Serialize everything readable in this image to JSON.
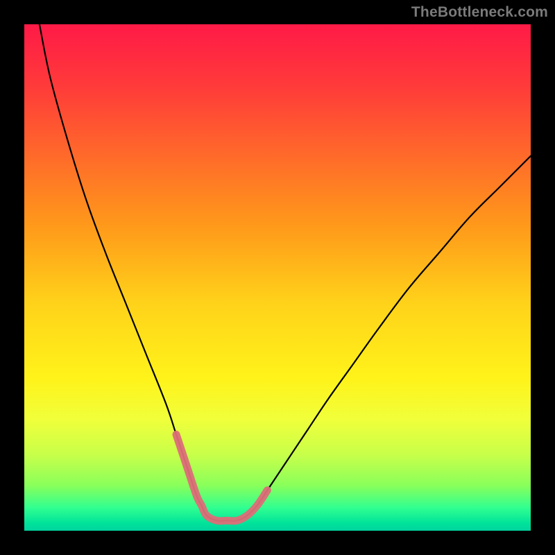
{
  "watermark": "TheBottleneck.com",
  "gradient": {
    "stops": [
      {
        "offset": 0.0,
        "color": "#ff1a47"
      },
      {
        "offset": 0.12,
        "color": "#ff3a3a"
      },
      {
        "offset": 0.26,
        "color": "#ff6a2a"
      },
      {
        "offset": 0.4,
        "color": "#ff9a1a"
      },
      {
        "offset": 0.55,
        "color": "#ffd21a"
      },
      {
        "offset": 0.7,
        "color": "#fff31a"
      },
      {
        "offset": 0.78,
        "color": "#f0ff3a"
      },
      {
        "offset": 0.85,
        "color": "#c8ff4a"
      },
      {
        "offset": 0.91,
        "color": "#8aff5a"
      },
      {
        "offset": 0.955,
        "color": "#30ff90"
      },
      {
        "offset": 0.985,
        "color": "#00e39a"
      },
      {
        "offset": 1.0,
        "color": "#00d49e"
      }
    ]
  },
  "chart_data": {
    "type": "line",
    "title": "",
    "xlabel": "",
    "ylabel": "",
    "xlim": [
      0,
      100
    ],
    "ylim": [
      0,
      100
    ],
    "grid": false,
    "legend": false,
    "series": [
      {
        "name": "bottleneck-curve",
        "x": [
          3,
          5,
          8,
          12,
          16,
          20,
          24,
          28,
          30,
          32,
          34,
          35,
          36,
          38,
          40,
          42,
          44,
          46,
          48,
          52,
          56,
          60,
          65,
          70,
          76,
          82,
          88,
          94,
          100
        ],
        "values": [
          100,
          90,
          79,
          66,
          55,
          45,
          35,
          25,
          19,
          13,
          7,
          5,
          3,
          2,
          2,
          2,
          3,
          5,
          8,
          14,
          20,
          26,
          33,
          40,
          48,
          55,
          62,
          68,
          74
        ]
      },
      {
        "name": "highlight-segment",
        "x": [
          30,
          32,
          34,
          35,
          36,
          38,
          40,
          42,
          44,
          46,
          48
        ],
        "values": [
          19,
          13,
          7,
          5,
          3,
          2,
          2,
          2,
          3,
          5,
          8
        ]
      }
    ],
    "notes": "Axes are unlabeled in the image; x/y values above are estimated as percentages of the plot area. The curve dips to its minimum near x≈38–40 (the optimal/no-bottleneck point) and rises towards red (high bottleneck) on both sides. The pink highlight marks the low-bottleneck region around the minimum."
  }
}
